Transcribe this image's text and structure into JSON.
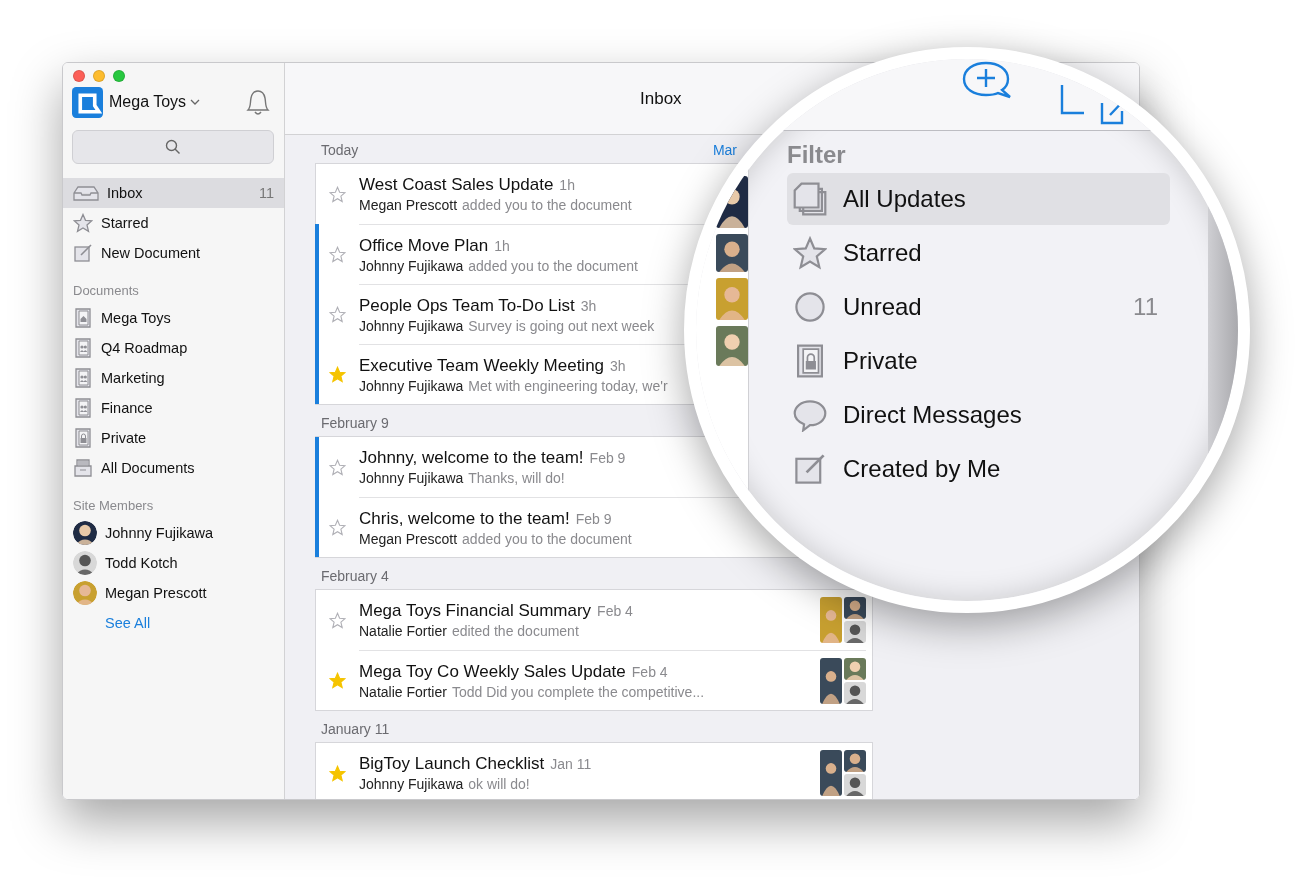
{
  "window": {
    "title": "Inbox"
  },
  "sidebar": {
    "workspace": "Mega Toys",
    "nav": [
      {
        "label": "Inbox",
        "kind": "inbox",
        "count": "11",
        "selected": true
      },
      {
        "label": "Starred",
        "kind": "star",
        "selected": false
      },
      {
        "label": "New Document",
        "kind": "compose",
        "selected": false
      }
    ],
    "sections": [
      {
        "title": "Documents",
        "items": [
          {
            "label": "Mega Toys",
            "kind": "home"
          },
          {
            "label": "Q4 Roadmap",
            "kind": "team"
          },
          {
            "label": "Marketing",
            "kind": "team"
          },
          {
            "label": "Finance",
            "kind": "team"
          },
          {
            "label": "Private",
            "kind": "lock"
          },
          {
            "label": "All Documents",
            "kind": "cabinet"
          }
        ]
      }
    ],
    "members_title": "Site Members",
    "members": [
      {
        "name": "Johnny Fujikawa"
      },
      {
        "name": "Todd Kotch"
      },
      {
        "name": "Megan Prescott"
      }
    ],
    "see_all": "See All"
  },
  "groups": [
    {
      "title": "Today",
      "action": "Mar",
      "rows": [
        {
          "title": "West Coast Sales Update",
          "time": "1h",
          "author": "Megan Prescott",
          "snippet": "added you to the document",
          "starred": false,
          "unread": false
        },
        {
          "title": "Office Move Plan",
          "time": "1h",
          "author": "Johnny Fujikawa",
          "snippet": "added you to the document",
          "starred": false,
          "unread": true
        },
        {
          "title": "People Ops Team To-Do List",
          "time": "3h",
          "author": "Johnny Fujikawa",
          "snippet": "Survey is going out next week",
          "starred": false,
          "unread": true
        },
        {
          "title": "Executive Team Weekly Meeting",
          "time": "3h",
          "author": "Johnny Fujikawa",
          "snippet": "Met with engineering today, we'r",
          "starred": true,
          "unread": true
        }
      ]
    },
    {
      "title": "February 9",
      "rows": [
        {
          "title": "Johnny, welcome to the team!",
          "time": "Feb 9",
          "author": "Johnny Fujikawa",
          "snippet": "Thanks, will do!",
          "starred": false,
          "unread": true
        },
        {
          "title": "Chris, welcome to the team!",
          "time": "Feb 9",
          "author": "Megan Prescott",
          "snippet": "added you to the document",
          "starred": false,
          "unread": true
        }
      ]
    },
    {
      "title": "February 4",
      "rows": [
        {
          "title": "Mega Toys Financial Summary",
          "time": "Feb 4",
          "author": "Natalie Fortier",
          "snippet": "edited the document",
          "starred": false,
          "unread": false
        },
        {
          "title": "Mega Toy Co Weekly Sales Update",
          "time": "Feb 4",
          "author": "Natalie Fortier",
          "snippet": "Todd Did you complete the competitive...",
          "starred": true,
          "unread": false
        }
      ]
    },
    {
      "title": "January 11",
      "rows": [
        {
          "title": "BigToy Launch Checklist",
          "time": "Jan 11",
          "author": "Johnny Fujikawa",
          "snippet": "ok will do!",
          "starred": true,
          "unread": false
        }
      ]
    }
  ],
  "filter_menu": {
    "title": "Filter",
    "items": [
      {
        "label": "All Updates",
        "kind": "pages",
        "selected": true
      },
      {
        "label": "Starred",
        "kind": "star",
        "selected": false
      },
      {
        "label": "Unread",
        "kind": "circle",
        "count": "11",
        "selected": false
      },
      {
        "label": "Private",
        "kind": "lock",
        "selected": false
      },
      {
        "label": "Direct Messages",
        "kind": "bubble",
        "selected": false
      },
      {
        "label": "Created by Me",
        "kind": "compose",
        "selected": false
      }
    ]
  }
}
